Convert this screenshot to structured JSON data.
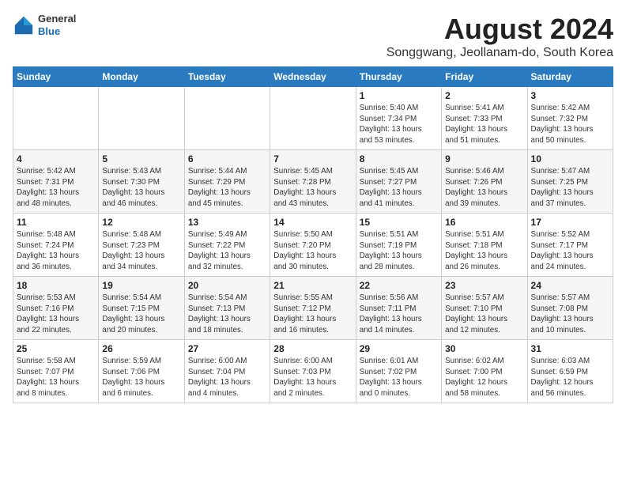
{
  "logo": {
    "general": "General",
    "blue": "Blue"
  },
  "title": "August 2024",
  "location": "Songgwang, Jeollanam-do, South Korea",
  "weekdays": [
    "Sunday",
    "Monday",
    "Tuesday",
    "Wednesday",
    "Thursday",
    "Friday",
    "Saturday"
  ],
  "weeks": [
    [
      {
        "day": "",
        "info": ""
      },
      {
        "day": "",
        "info": ""
      },
      {
        "day": "",
        "info": ""
      },
      {
        "day": "",
        "info": ""
      },
      {
        "day": "1",
        "info": "Sunrise: 5:40 AM\nSunset: 7:34 PM\nDaylight: 13 hours\nand 53 minutes."
      },
      {
        "day": "2",
        "info": "Sunrise: 5:41 AM\nSunset: 7:33 PM\nDaylight: 13 hours\nand 51 minutes."
      },
      {
        "day": "3",
        "info": "Sunrise: 5:42 AM\nSunset: 7:32 PM\nDaylight: 13 hours\nand 50 minutes."
      }
    ],
    [
      {
        "day": "4",
        "info": "Sunrise: 5:42 AM\nSunset: 7:31 PM\nDaylight: 13 hours\nand 48 minutes."
      },
      {
        "day": "5",
        "info": "Sunrise: 5:43 AM\nSunset: 7:30 PM\nDaylight: 13 hours\nand 46 minutes."
      },
      {
        "day": "6",
        "info": "Sunrise: 5:44 AM\nSunset: 7:29 PM\nDaylight: 13 hours\nand 45 minutes."
      },
      {
        "day": "7",
        "info": "Sunrise: 5:45 AM\nSunset: 7:28 PM\nDaylight: 13 hours\nand 43 minutes."
      },
      {
        "day": "8",
        "info": "Sunrise: 5:45 AM\nSunset: 7:27 PM\nDaylight: 13 hours\nand 41 minutes."
      },
      {
        "day": "9",
        "info": "Sunrise: 5:46 AM\nSunset: 7:26 PM\nDaylight: 13 hours\nand 39 minutes."
      },
      {
        "day": "10",
        "info": "Sunrise: 5:47 AM\nSunset: 7:25 PM\nDaylight: 13 hours\nand 37 minutes."
      }
    ],
    [
      {
        "day": "11",
        "info": "Sunrise: 5:48 AM\nSunset: 7:24 PM\nDaylight: 13 hours\nand 36 minutes."
      },
      {
        "day": "12",
        "info": "Sunrise: 5:48 AM\nSunset: 7:23 PM\nDaylight: 13 hours\nand 34 minutes."
      },
      {
        "day": "13",
        "info": "Sunrise: 5:49 AM\nSunset: 7:22 PM\nDaylight: 13 hours\nand 32 minutes."
      },
      {
        "day": "14",
        "info": "Sunrise: 5:50 AM\nSunset: 7:20 PM\nDaylight: 13 hours\nand 30 minutes."
      },
      {
        "day": "15",
        "info": "Sunrise: 5:51 AM\nSunset: 7:19 PM\nDaylight: 13 hours\nand 28 minutes."
      },
      {
        "day": "16",
        "info": "Sunrise: 5:51 AM\nSunset: 7:18 PM\nDaylight: 13 hours\nand 26 minutes."
      },
      {
        "day": "17",
        "info": "Sunrise: 5:52 AM\nSunset: 7:17 PM\nDaylight: 13 hours\nand 24 minutes."
      }
    ],
    [
      {
        "day": "18",
        "info": "Sunrise: 5:53 AM\nSunset: 7:16 PM\nDaylight: 13 hours\nand 22 minutes."
      },
      {
        "day": "19",
        "info": "Sunrise: 5:54 AM\nSunset: 7:15 PM\nDaylight: 13 hours\nand 20 minutes."
      },
      {
        "day": "20",
        "info": "Sunrise: 5:54 AM\nSunset: 7:13 PM\nDaylight: 13 hours\nand 18 minutes."
      },
      {
        "day": "21",
        "info": "Sunrise: 5:55 AM\nSunset: 7:12 PM\nDaylight: 13 hours\nand 16 minutes."
      },
      {
        "day": "22",
        "info": "Sunrise: 5:56 AM\nSunset: 7:11 PM\nDaylight: 13 hours\nand 14 minutes."
      },
      {
        "day": "23",
        "info": "Sunrise: 5:57 AM\nSunset: 7:10 PM\nDaylight: 13 hours\nand 12 minutes."
      },
      {
        "day": "24",
        "info": "Sunrise: 5:57 AM\nSunset: 7:08 PM\nDaylight: 13 hours\nand 10 minutes."
      }
    ],
    [
      {
        "day": "25",
        "info": "Sunrise: 5:58 AM\nSunset: 7:07 PM\nDaylight: 13 hours\nand 8 minutes."
      },
      {
        "day": "26",
        "info": "Sunrise: 5:59 AM\nSunset: 7:06 PM\nDaylight: 13 hours\nand 6 minutes."
      },
      {
        "day": "27",
        "info": "Sunrise: 6:00 AM\nSunset: 7:04 PM\nDaylight: 13 hours\nand 4 minutes."
      },
      {
        "day": "28",
        "info": "Sunrise: 6:00 AM\nSunset: 7:03 PM\nDaylight: 13 hours\nand 2 minutes."
      },
      {
        "day": "29",
        "info": "Sunrise: 6:01 AM\nSunset: 7:02 PM\nDaylight: 13 hours\nand 0 minutes."
      },
      {
        "day": "30",
        "info": "Sunrise: 6:02 AM\nSunset: 7:00 PM\nDaylight: 12 hours\nand 58 minutes."
      },
      {
        "day": "31",
        "info": "Sunrise: 6:03 AM\nSunset: 6:59 PM\nDaylight: 12 hours\nand 56 minutes."
      }
    ]
  ]
}
